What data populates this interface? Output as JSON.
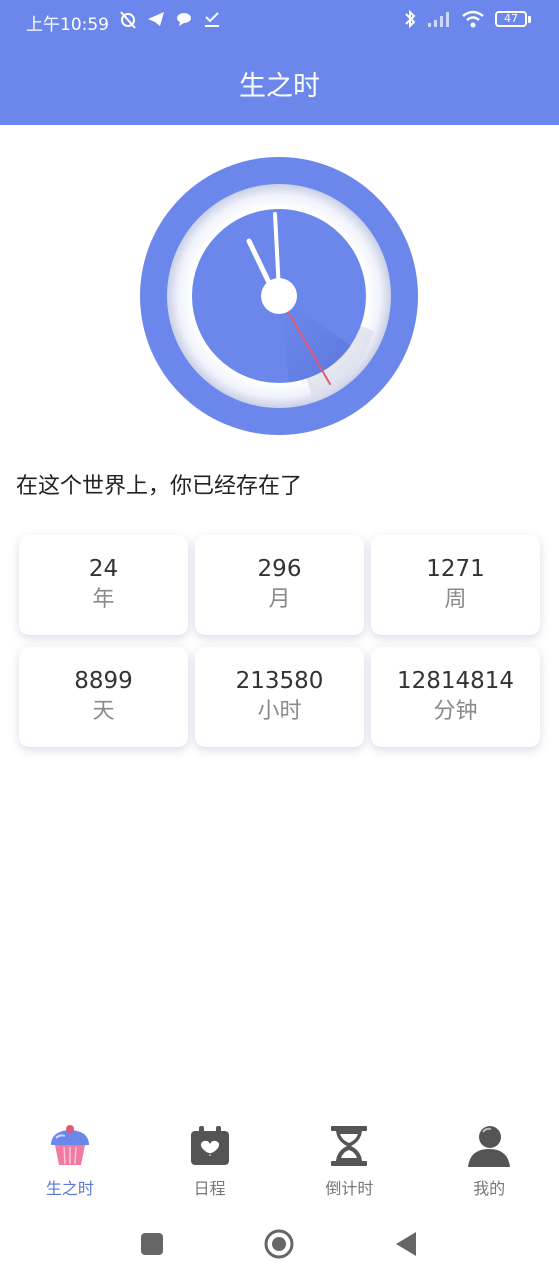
{
  "status_bar": {
    "time": "上午10:59",
    "battery": "47"
  },
  "header": {
    "title": "生之时"
  },
  "intro_text": "在这个世界上，你已经存在了",
  "stats": [
    {
      "value": "24",
      "unit": "年"
    },
    {
      "value": "296",
      "unit": "月"
    },
    {
      "value": "1271",
      "unit": "周"
    },
    {
      "value": "8899",
      "unit": "天"
    },
    {
      "value": "213580",
      "unit": "小时"
    },
    {
      "value": "12814814",
      "unit": "分钟"
    }
  ],
  "tabs": [
    {
      "label": "生之时",
      "icon": "cupcake-icon",
      "active": true
    },
    {
      "label": "日程",
      "icon": "calendar-heart-icon",
      "active": false
    },
    {
      "label": "倒计时",
      "icon": "hourglass-icon",
      "active": false
    },
    {
      "label": "我的",
      "icon": "user-icon",
      "active": false
    }
  ],
  "colors": {
    "primary": "#6b87ec",
    "active_tab": "#5a78dc",
    "second_hand": "#e2587a"
  }
}
